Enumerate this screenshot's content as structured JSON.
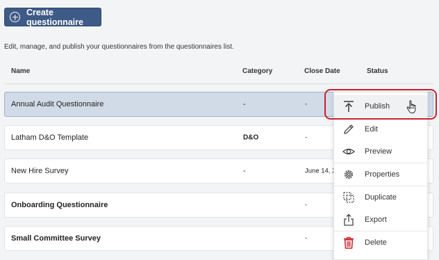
{
  "toolbar": {
    "create_label": "Create questionnaire"
  },
  "description": "Edit, manage, and publish your questionnaires from the questionnaires list.",
  "table": {
    "headers": [
      "Name",
      "Category",
      "Close Date",
      "Status"
    ],
    "rows": [
      {
        "name": "Annual Audit Questionnaire",
        "category": "-",
        "close_date": "-"
      },
      {
        "name": "Latham D&O Template",
        "category": "D&O",
        "close_date": "-"
      },
      {
        "name": "New Hire Survey",
        "category": "-",
        "close_date": "June 14, 20"
      },
      {
        "name": "Onboarding Questionnaire",
        "category": "",
        "close_date": "-"
      },
      {
        "name": "Small Committee Survey",
        "category": "",
        "close_date": "-"
      }
    ]
  },
  "menu": {
    "items": [
      {
        "label": "Publish",
        "icon": "publish-icon"
      },
      {
        "label": "Edit",
        "icon": "pencil-icon"
      },
      {
        "label": "Preview",
        "icon": "eye-icon"
      },
      {
        "label": "Properties",
        "icon": "gear-icon"
      },
      {
        "label": "Duplicate",
        "icon": "duplicate-icon"
      },
      {
        "label": "Export",
        "icon": "export-icon"
      },
      {
        "label": "Delete",
        "icon": "trash-icon"
      }
    ]
  },
  "colors": {
    "primary_button": "#3e5a86",
    "selected_row": "#d1dbe8",
    "highlight_outline": "#c8202a",
    "delete_icon": "#c8202a"
  }
}
